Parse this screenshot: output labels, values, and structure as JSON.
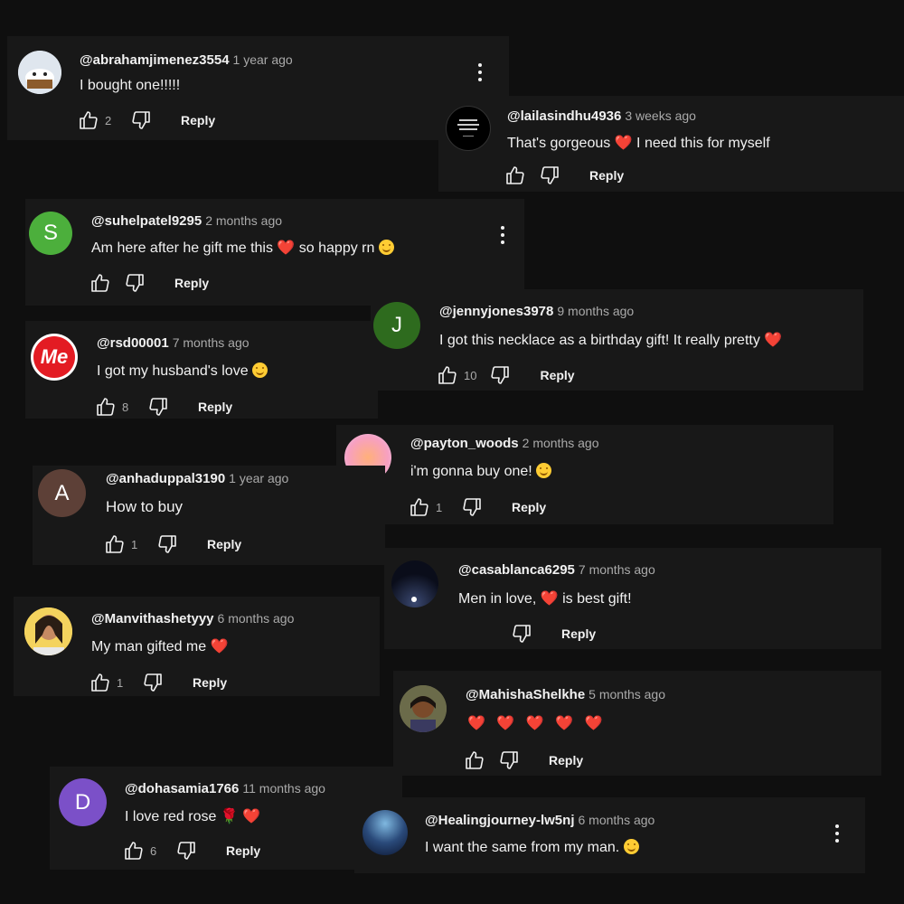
{
  "reply_label": "Reply",
  "colors": {
    "background": "#0f0f0f",
    "card": "#181818",
    "heart": "#e0245e",
    "avatar_s": "#4caf3c",
    "avatar_j": "#2e6b1e",
    "avatar_a": "#5d4037",
    "avatar_d": "#7b50c8"
  },
  "comments": [
    {
      "handle": "@abrahamjimenez3554",
      "time": "1 year ago",
      "text": "I bought one!!!!!",
      "likes": "2"
    },
    {
      "handle": "@lailasindhu4936",
      "time": "3 weeks ago",
      "text_a": "That's gorgeous ",
      "heart": "❤️",
      "text_b": " I need this for myself",
      "likes": ""
    },
    {
      "handle": "@suhelpatel9295",
      "time": "2 months ago",
      "text_a": "Am here after he gift me this ",
      "heart": "❤️",
      "text_b": " so happy rn",
      "likes": "",
      "avatar_letter": "S"
    },
    {
      "handle": "@jennyjones3978",
      "time": "9 months ago",
      "text_a": "I got this necklace as a birthday gift! It really pretty ",
      "heart": "❤️",
      "likes": "10",
      "avatar_letter": "J"
    },
    {
      "handle": "@rsd00001",
      "time": "7 months ago",
      "text_a": "I got my husband's love ",
      "likes": "8",
      "avatar_logo": "Me"
    },
    {
      "handle": "@payton_woods",
      "time": "2 months ago",
      "text_a": "i'm gonna buy one! ",
      "likes": "1"
    },
    {
      "handle": "@anhaduppal3190",
      "time": "1 year ago",
      "text": "How to buy",
      "likes": "1",
      "avatar_letter": "A"
    },
    {
      "handle": "@casablanca6295",
      "time": "7 months ago",
      "text_a": "Men in love, ",
      "heart": "❤️",
      "text_b": " is best gift!"
    },
    {
      "handle": "@Manvithashetyyy",
      "time": "6 months ago",
      "text_a": "My man gifted me ",
      "heart": "❤️",
      "likes": "1"
    },
    {
      "handle": "@MahishaShelkhe",
      "time": "5 months ago",
      "hearts": "❤️ ❤️ ❤️ ❤️ ❤️"
    },
    {
      "handle": "@dohasamia1766",
      "time": "11 months ago",
      "text_a": "I love red rose ",
      "rose": "🌹",
      "heart": "❤️",
      "likes": "6",
      "avatar_letter": "D"
    },
    {
      "handle": "@Healingjourney-lw5nj",
      "time": "6 months ago",
      "text_a": "I want the same from my man. "
    }
  ]
}
